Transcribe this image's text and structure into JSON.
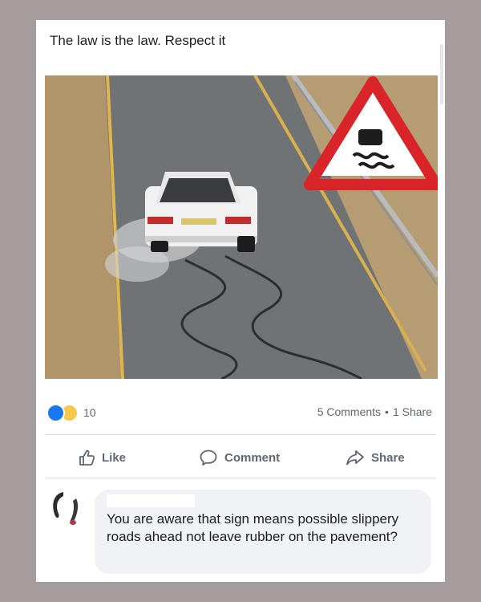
{
  "post": {
    "text": "The law is the law. Respect it",
    "image": {
      "subject": "white-car-drifting-on-road",
      "sign": "slippery-road-warning-sign"
    }
  },
  "reactions": {
    "icons": [
      "like-icon",
      "haha-icon"
    ],
    "count": "10"
  },
  "stats": {
    "comments": "5 Comments",
    "separator": "•",
    "shares": "1 Share"
  },
  "actions": {
    "like": "Like",
    "comment": "Comment",
    "share": "Share"
  },
  "comment": {
    "text": "You are aware that sign means possible slippery roads ahead not leave rubber on the pavement?"
  },
  "colors": {
    "background": "#a69c9e",
    "card": "#ffffff",
    "text": "#1c1e21",
    "secondary_text": "#606770",
    "like_blue": "#1877f2",
    "bubble": "#f0f2f5",
    "sign_red": "#d9242a"
  }
}
